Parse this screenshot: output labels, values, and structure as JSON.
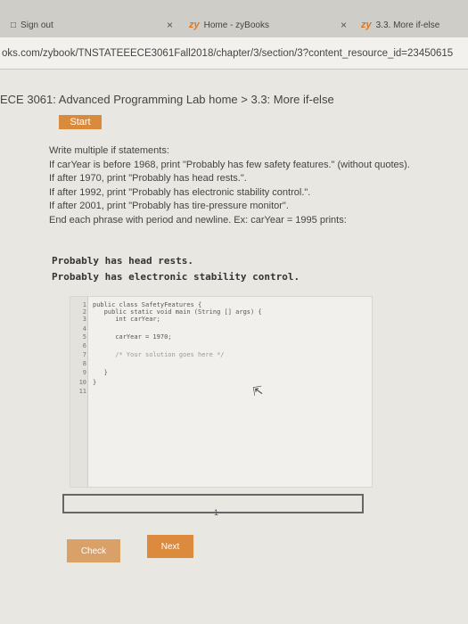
{
  "browser": {
    "tabs": [
      {
        "icon": "document-icon",
        "title": "Sign out",
        "close": "×"
      },
      {
        "icon": "zy",
        "title": "Home - zyBooks",
        "close": "×"
      },
      {
        "icon": "zy",
        "title": "3.3. More if-else"
      }
    ],
    "url": "oks.com/zybook/TNSTATEEECE3061Fall2018/chapter/3/section/3?content_resource_id=23450615"
  },
  "breadcrumb": "ECE 3061: Advanced Programming Lab home > 3.3: More if-else",
  "start_label": "Start",
  "instructions": [
    "Write multiple if statements:",
    "If carYear is before 1968, print \"Probably has few safety features.\" (without quotes).",
    "If after 1970, print \"Probably has head rests.\".",
    "If after 1992, print \"Probably has electronic stability control.\".",
    "If after 2001, print \"Probably has tire-pressure monitor\".",
    "End each phrase with period and newline. Ex: carYear = 1995 prints:"
  ],
  "expected_output": [
    "Probably has head rests.",
    "Probably has electronic stability control."
  ],
  "code_lines": [
    {
      "n": "1",
      "text": "public class SafetyFeatures {"
    },
    {
      "n": "2",
      "text": "   public static void main (String [] args) {"
    },
    {
      "n": "3",
      "text": "      int carYear;"
    },
    {
      "n": "4",
      "text": ""
    },
    {
      "n": "5",
      "text": "      carYear = 1970;"
    },
    {
      "n": "6",
      "text": ""
    },
    {
      "n": "7",
      "text": "      /* Your solution goes here */"
    },
    {
      "n": "8",
      "text": ""
    },
    {
      "n": "9",
      "text": "   }"
    },
    {
      "n": "10",
      "text": "}"
    },
    {
      "n": "11",
      "text": ""
    }
  ],
  "test_number": "1",
  "check_label": "Check",
  "next_label": "Next"
}
